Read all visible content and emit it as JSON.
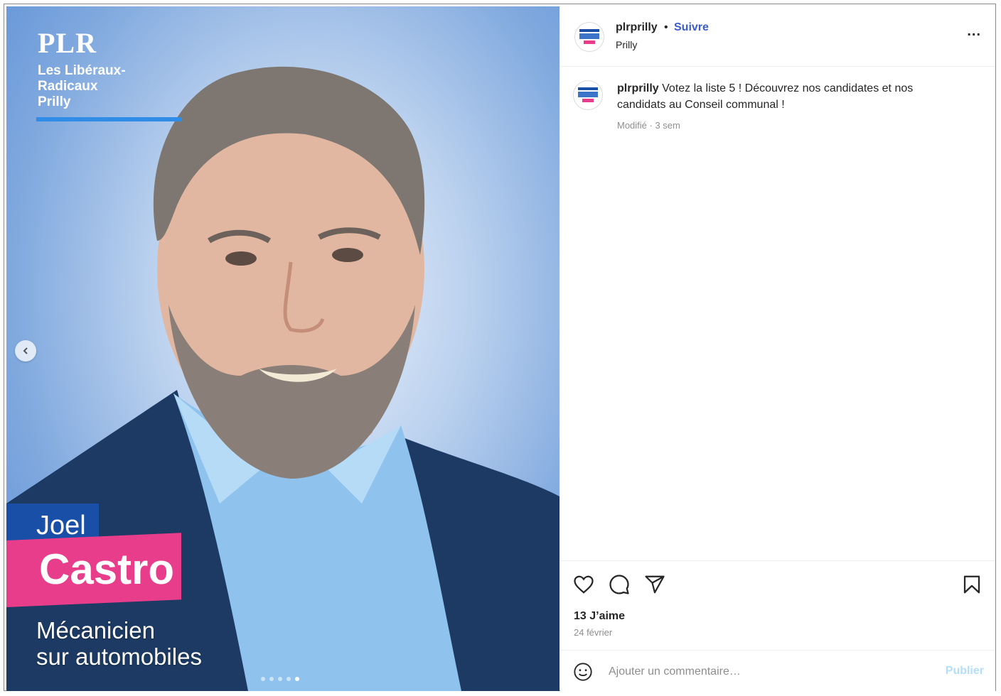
{
  "media": {
    "brand_name": "PLR",
    "brand_line1": "Les Libéraux-Radicaux",
    "brand_line2": "Prilly",
    "first_name": "Joel",
    "last_name": "Castro",
    "job_line1": "Mécanicien",
    "job_line2": "sur automobiles",
    "carousel_dots": 5,
    "carousel_active": 5
  },
  "header": {
    "username": "plrprilly",
    "separator": "•",
    "follow_label": "Suivre",
    "location": "Prilly",
    "more_label": "..."
  },
  "caption": {
    "username": "plrprilly",
    "text": "Votez la liste 5 ! Découvrez nos candidates et nos candidats au Conseil communal !",
    "meta": "Modifié · 3 sem"
  },
  "actions": {
    "icons": [
      "heart-icon",
      "comment-icon",
      "share-icon",
      "bookmark-icon"
    ],
    "likes": "13 J’aime",
    "date": "24 février"
  },
  "comment": {
    "placeholder": "Ajouter un commentaire…",
    "publish_label": "Publier"
  },
  "colors": {
    "brand_blue": "#1a4fa8",
    "brand_pink": "#e83d8a",
    "follow_blue": "#3a5ccc",
    "publish_disabled": "#b2dffc"
  }
}
